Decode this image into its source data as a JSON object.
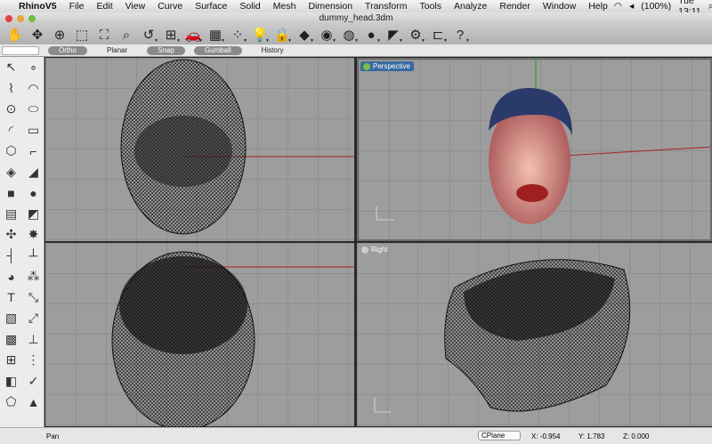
{
  "menubar": {
    "apple": "",
    "app": "RhinoV5",
    "items": [
      "File",
      "Edit",
      "View",
      "Curve",
      "Surface",
      "Solid",
      "Mesh",
      "Dimension",
      "Transform",
      "Tools",
      "Analyze",
      "Render",
      "Window",
      "Help"
    ],
    "battery": "(100%)",
    "clock": "Tue 13:11"
  },
  "window": {
    "title": "dummy_head.3dm"
  },
  "toolbar": {
    "icons": [
      "pan",
      "rotate",
      "zoom",
      "zoom-window",
      "zoom-extents",
      "zoom-selected",
      "undo-view",
      "four-viewports",
      "car-render",
      "cplane",
      "osnap",
      "light",
      "lock",
      "layers",
      "color-wheel",
      "sphere-display",
      "shaded-sphere",
      "spotlight",
      "gear",
      "grouping",
      "help"
    ],
    "glyphs": [
      "✋",
      "✥",
      "⊕",
      "⬚",
      "⛶",
      "⌕",
      "↺",
      "⊞",
      "🚗",
      "▦",
      "⁘",
      "💡",
      "🔒",
      "◆",
      "◉",
      "◍",
      "●",
      "◤",
      "⚙",
      "⊏",
      "?"
    ]
  },
  "modebar": {
    "modes": [
      {
        "label": "Ortho",
        "on": true
      },
      {
        "label": "Planar",
        "on": false
      },
      {
        "label": "Snap",
        "on": true
      },
      {
        "label": "Gumball",
        "on": true
      },
      {
        "label": "History",
        "on": false
      }
    ]
  },
  "lefttoolbar": {
    "icons": [
      "select",
      "point",
      "polyline",
      "curve",
      "circle",
      "ellipse",
      "arc",
      "rectangle",
      "polygon",
      "fillet",
      "surface-from-points",
      "sweep",
      "box",
      "sphere",
      "cylinder",
      "panel",
      "transform",
      "explode",
      "trim",
      "split",
      "boolean",
      "group",
      "text",
      "scale",
      "block",
      "move",
      "array",
      "dimension",
      "grid",
      "array-polar",
      "analyze",
      "check",
      "mesh",
      "render"
    ],
    "glyphs": [
      "↖",
      "∘",
      "⌇",
      "◠",
      "⊙",
      "⬭",
      "◜",
      "▭",
      "⬡",
      "⌐",
      "◈",
      "◢",
      "■",
      "●",
      "▤",
      "◩",
      "✣",
      "✸",
      "┤",
      "┴",
      "◕",
      "⁂",
      "T",
      "⤡",
      "▧",
      "⤢",
      "▩",
      "⊥",
      "⊞",
      "⋮",
      "◧",
      "✓",
      "⬠",
      "▲"
    ]
  },
  "viewports": {
    "perspective": {
      "label": "Perspective"
    },
    "right": {
      "label": "Right"
    }
  },
  "status": {
    "command": "Pan",
    "cplane": "CPlane",
    "x": "X: -0.954",
    "y": "Y: 1.783",
    "z": "Z: 0.000"
  },
  "colors": {
    "viewport_bg": "#9d9d9d",
    "active_label": "#3a6aa0",
    "x_axis": "#b02020",
    "y_axis": "#20a020"
  }
}
